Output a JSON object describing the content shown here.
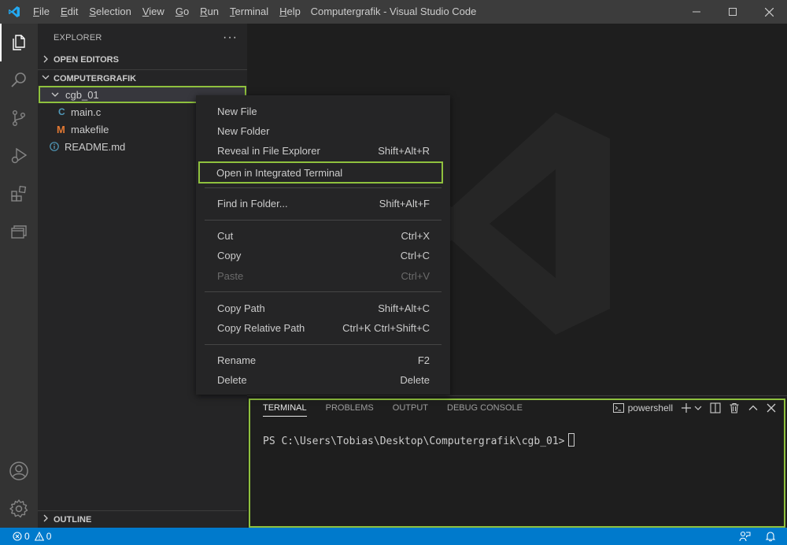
{
  "titlebar": {
    "title": "Computergrafik - Visual Studio Code",
    "menu": [
      {
        "u": "F",
        "rest": "ile"
      },
      {
        "u": "E",
        "rest": "dit"
      },
      {
        "u": "S",
        "rest": "election"
      },
      {
        "u": "V",
        "rest": "iew"
      },
      {
        "u": "G",
        "rest": "o"
      },
      {
        "u": "R",
        "rest": "un"
      },
      {
        "u": "T",
        "rest": "erminal"
      },
      {
        "u": "H",
        "rest": "elp"
      }
    ]
  },
  "sidebar": {
    "title": "EXPLORER",
    "open_editors": "OPEN EDITORS",
    "folder": "COMPUTERGRAFIK",
    "tree": {
      "folder_name": "cgb_01",
      "file1": "main.c",
      "file1_icon_glyph": "C",
      "file2": "makefile",
      "file2_icon_glyph": "M",
      "file3": "README.md"
    },
    "outline": "OUTLINE"
  },
  "context_menu": {
    "new_file": "New File",
    "new_folder": "New Folder",
    "reveal": "Reveal in File Explorer",
    "reveal_key": "Shift+Alt+R",
    "open_terminal": "Open in Integrated Terminal",
    "find": "Find in Folder...",
    "find_key": "Shift+Alt+F",
    "cut": "Cut",
    "cut_key": "Ctrl+X",
    "copy": "Copy",
    "copy_key": "Ctrl+C",
    "paste": "Paste",
    "paste_key": "Ctrl+V",
    "copy_path": "Copy Path",
    "copy_path_key": "Shift+Alt+C",
    "copy_rel": "Copy Relative Path",
    "copy_rel_key": "Ctrl+K Ctrl+Shift+C",
    "rename": "Rename",
    "rename_key": "F2",
    "delete": "Delete",
    "delete_key": "Delete"
  },
  "panel": {
    "tabs": [
      "TERMINAL",
      "PROBLEMS",
      "OUTPUT",
      "DEBUG CONSOLE"
    ],
    "shell": "powershell",
    "prompt": "PS C:\\Users\\Tobias\\Desktop\\Computergrafik\\cgb_01>"
  },
  "statusbar": {
    "errors": "0",
    "warnings": "0"
  },
  "colors": {
    "accent": "#007acc",
    "highlight_outline": "#8fc13e",
    "c_icon": "#519aba",
    "m_icon": "#e37933"
  }
}
